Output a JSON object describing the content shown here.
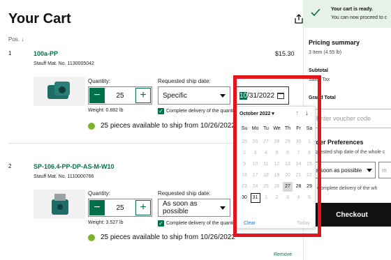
{
  "header": {
    "title": "Your Cart",
    "sort_label": "Pos. ↓"
  },
  "items": [
    {
      "pos": "1",
      "name": "100a-PP",
      "mat_no": "Stauff Mat. No. 1130005042",
      "price": "$15.30",
      "quantity_label": "Quantity:",
      "quantity": "25",
      "ship_label": "Requested ship date:",
      "ship_option": "Specific",
      "date_value": "10/31/2022",
      "date_value_month": "10",
      "date_value_rest": "/31/2022",
      "weight": "Weight: 0.882 lb",
      "complete_label": "Complete delivery of the quantity",
      "availability": "25 pieces available to ship from 10/26/2022"
    },
    {
      "pos": "2",
      "name": "SP-106.4-PP-DP-AS-M-W10",
      "mat_no": "Stauff Mat. No. 1110000766",
      "quantity_label": "Quantity:",
      "quantity": "25",
      "ship_label": "Requested ship date:",
      "ship_option": "As soon as possible",
      "weight": "Weight: 3.527 lb",
      "complete_label": "Complete delivery of the quantity",
      "availability": "25 pieces available to ship from 10/26/2022",
      "remove_label": "Remove"
    }
  ],
  "calendar": {
    "month_label": "October 2022 ▾",
    "weekdays": [
      "Su",
      "Mo",
      "Tu",
      "We",
      "Th",
      "Fr",
      "Sa"
    ],
    "weeks": [
      [
        "25",
        "26",
        "27",
        "28",
        "29",
        "30",
        "1"
      ],
      [
        "2",
        "3",
        "4",
        "5",
        "6",
        "7",
        "8"
      ],
      [
        "9",
        "10",
        "11",
        "12",
        "13",
        "14",
        "15"
      ],
      [
        "16",
        "17",
        "18",
        "19",
        "20",
        "21",
        "22"
      ],
      [
        "23",
        "24",
        "25",
        "26",
        "27",
        "28",
        "29"
      ],
      [
        "30",
        "31",
        "1",
        "2",
        "3",
        "4",
        "5"
      ]
    ],
    "available_from": "27",
    "today": "27",
    "selected": "31",
    "clear_label": "Clear",
    "today_label": "Today"
  },
  "sidebar": {
    "toast_title": "Your cart is ready.",
    "toast_text": "You can now proceed to c",
    "pricing_title": "Pricing summary",
    "pricing_items": "3 Item (4.55 lb)",
    "subtotal_label": "Subtotal",
    "sales_tax_label": "Sales Tax",
    "grand_total_label": "Grand Total",
    "voucher_placeholder": "Enter voucher code",
    "prefs_title": "Order Preferences",
    "prefs_sub": "Requested ship date of the whole c",
    "prefs_ship": "As soon as possible",
    "prefs_second": "m",
    "prefs_complete": "Complete delivery of the wh",
    "checkout_label": "Checkout"
  },
  "colors": {
    "brand": "#00704a",
    "highlight": "#e0161c",
    "available": "#7ab52b"
  }
}
